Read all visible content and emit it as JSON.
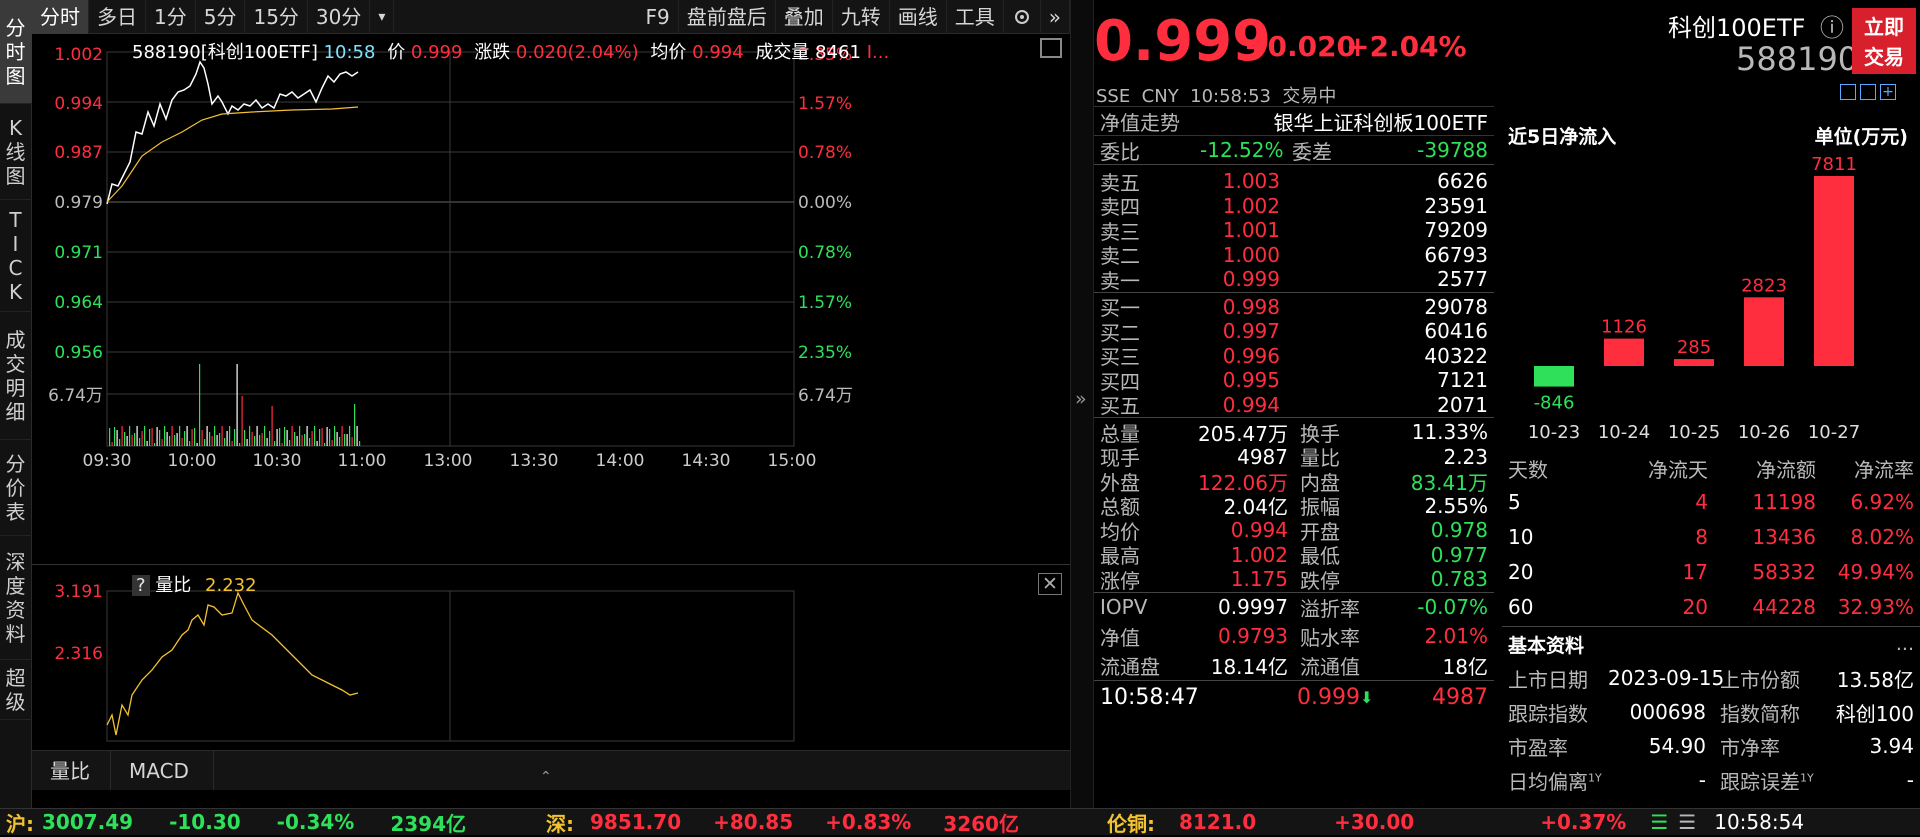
{
  "sidebar": [
    "分时图",
    "K线图",
    "TICK",
    "成交明细",
    "分价表",
    "深度资料",
    "超级"
  ],
  "topbar": {
    "tabs": [
      "分时",
      "多日",
      "1分",
      "5分",
      "15分",
      "30分"
    ],
    "more": "▾",
    "right": [
      "F9",
      "盘前盘后",
      "叠加",
      "九转",
      "画线",
      "工具"
    ]
  },
  "chart_header": {
    "code": "588190[科创100ETF]",
    "time": "10:58",
    "price_label": "价",
    "price": "0.999",
    "chg_label": "涨跌",
    "chg": "0.020(2.04%)",
    "avg_label": "均价",
    "avg": "0.994",
    "vol_label": "成交量",
    "vol": "8461",
    "more": "I..."
  },
  "left_axis": [
    "1.002",
    "0.994",
    "0.987",
    "0.979",
    "0.971",
    "0.964",
    "0.956",
    "6.74万"
  ],
  "right_axis": [
    "2.35%",
    "1.57%",
    "0.78%",
    "0.00%",
    "0.78%",
    "1.57%",
    "2.35%",
    "6.74万"
  ],
  "time_axis": [
    "09:30",
    "10:00",
    "10:30",
    "11:00",
    "13:00",
    "13:30",
    "14:00",
    "14:30",
    "15:00"
  ],
  "sub_header": {
    "q": "?",
    "label": "量比",
    "value": "2.232"
  },
  "sub_axis": [
    "3.191",
    "2.316"
  ],
  "sub_tabs": [
    "量比",
    "MACD"
  ],
  "colors": {
    "up": "#ff2e3e",
    "down": "#2ee05a",
    "price_line": "#ffffff",
    "avg_line": "#f2c230"
  },
  "quote": {
    "price": "0.999",
    "chg": "+0.020",
    "pct": "+2.04%",
    "name": "科创100ETF",
    "code": "588190",
    "info_icon": "ⓘ",
    "buy_btn": "立即交易",
    "market": "SSE  CNY  10:58:53  交易中"
  },
  "nav": {
    "label": "净值走势",
    "fund": "银华上证科创板100ETF"
  },
  "weibi": {
    "label": "委比",
    "value": "-12.52%",
    "diff_label": "委差",
    "diff": "-39788"
  },
  "asks": [
    {
      "label": "卖五",
      "price": "1.003",
      "vol": "6626"
    },
    {
      "label": "卖四",
      "price": "1.002",
      "vol": "23591"
    },
    {
      "label": "卖三",
      "price": "1.001",
      "vol": "79209"
    },
    {
      "label": "卖二",
      "price": "1.000",
      "vol": "66793"
    },
    {
      "label": "卖一",
      "price": "0.999",
      "vol": "2577"
    }
  ],
  "bids": [
    {
      "label": "买一",
      "price": "0.998",
      "vol": "29078"
    },
    {
      "label": "买二",
      "price": "0.997",
      "vol": "60416"
    },
    {
      "label": "买三",
      "price": "0.996",
      "vol": "40322"
    },
    {
      "label": "买四",
      "price": "0.995",
      "vol": "7121"
    },
    {
      "label": "买五",
      "price": "0.994",
      "vol": "2071"
    }
  ],
  "stats": [
    [
      {
        "l": "总量",
        "v": "205.47万",
        "c": "white"
      },
      {
        "l": "换手",
        "v": "11.33%",
        "c": "white"
      }
    ],
    [
      {
        "l": "现手",
        "v": "4987",
        "c": "white"
      },
      {
        "l": "量比",
        "v": "2.23",
        "c": "white"
      }
    ],
    [
      {
        "l": "外盘",
        "v": "122.06万",
        "c": "red"
      },
      {
        "l": "内盘",
        "v": "83.41万",
        "c": "green"
      }
    ],
    [
      {
        "l": "总额",
        "v": "2.04亿",
        "c": "white"
      },
      {
        "l": "振幅",
        "v": "2.55%",
        "c": "white"
      }
    ],
    [
      {
        "l": "均价",
        "v": "0.994",
        "c": "red"
      },
      {
        "l": "开盘",
        "v": "0.978",
        "c": "green"
      }
    ],
    [
      {
        "l": "最高",
        "v": "1.002",
        "c": "red"
      },
      {
        "l": "最低",
        "v": "0.977",
        "c": "green"
      }
    ],
    [
      {
        "l": "涨停",
        "v": "1.175",
        "c": "red"
      },
      {
        "l": "跌停",
        "v": "0.783",
        "c": "green"
      }
    ]
  ],
  "iopv": [
    [
      {
        "l": "IOPV",
        "v": "0.9997",
        "c": "white"
      },
      {
        "l": "溢折率",
        "v": "-0.07%",
        "c": "green"
      }
    ],
    [
      {
        "l": "净值",
        "v": "0.9793",
        "c": "red"
      },
      {
        "l": "贴水率",
        "v": "2.01%",
        "c": "red"
      }
    ],
    [
      {
        "l": "流通盘",
        "v": "18.14亿",
        "c": "white"
      },
      {
        "l": "流通值",
        "v": "18亿",
        "c": "white"
      }
    ]
  ],
  "last_tick": {
    "time": "10:58:47",
    "price": "0.999",
    "arrow": "⬇",
    "vol": "4987"
  },
  "flow": {
    "title": "近5日净流入",
    "unit": "单位(万元)",
    "chart_data": {
      "type": "bar",
      "categories": [
        "10-23",
        "10-24",
        "10-25",
        "10-26",
        "10-27"
      ],
      "values": [
        -846,
        1126,
        285,
        2823,
        7811
      ],
      "title": "近5日净流入",
      "ylabel": "单位(万元)"
    }
  },
  "flow_table": {
    "headers": [
      "天数",
      "净流天",
      "净流额",
      "净流率"
    ],
    "rows": [
      [
        "5",
        "4",
        "11198",
        "6.92%"
      ],
      [
        "10",
        "8",
        "13436",
        "8.02%"
      ],
      [
        "20",
        "17",
        "58332",
        "49.94%"
      ],
      [
        "60",
        "20",
        "44228",
        "32.93%"
      ]
    ]
  },
  "basic": {
    "title": "基本资料",
    "more": "...",
    "rows": [
      [
        {
          "l": "上市日期",
          "v": "2023-09-15"
        },
        {
          "l": "上市份额",
          "v": "13.58亿"
        }
      ],
      [
        {
          "l": "跟踪指数",
          "v": "000698"
        },
        {
          "l": "指数简称",
          "v": "科创100"
        }
      ],
      [
        {
          "l": "市盈率",
          "v": "54.90"
        },
        {
          "l": "市净率",
          "v": "3.94"
        }
      ],
      [
        {
          "l": "日均偏离",
          "sup": "1Y",
          "v": "-"
        },
        {
          "l": "跟踪误差",
          "sup": "1Y",
          "v": "-"
        }
      ]
    ]
  },
  "status": {
    "sh_label": "沪:",
    "sh": "3007.49",
    "sh_chg": "-10.30",
    "sh_pct": "-0.34%",
    "sh_amt": "2394亿",
    "sz_label": "深:",
    "sz": "9851.70",
    "sz_chg": "+80.85",
    "sz_pct": "+0.83%",
    "sz_amt": "3260亿",
    "cu_label": "伦铜:",
    "cu": "8121.0",
    "cu_chg": "+30.00",
    "cu_pct": "+0.37%",
    "time": "10:58:54"
  }
}
